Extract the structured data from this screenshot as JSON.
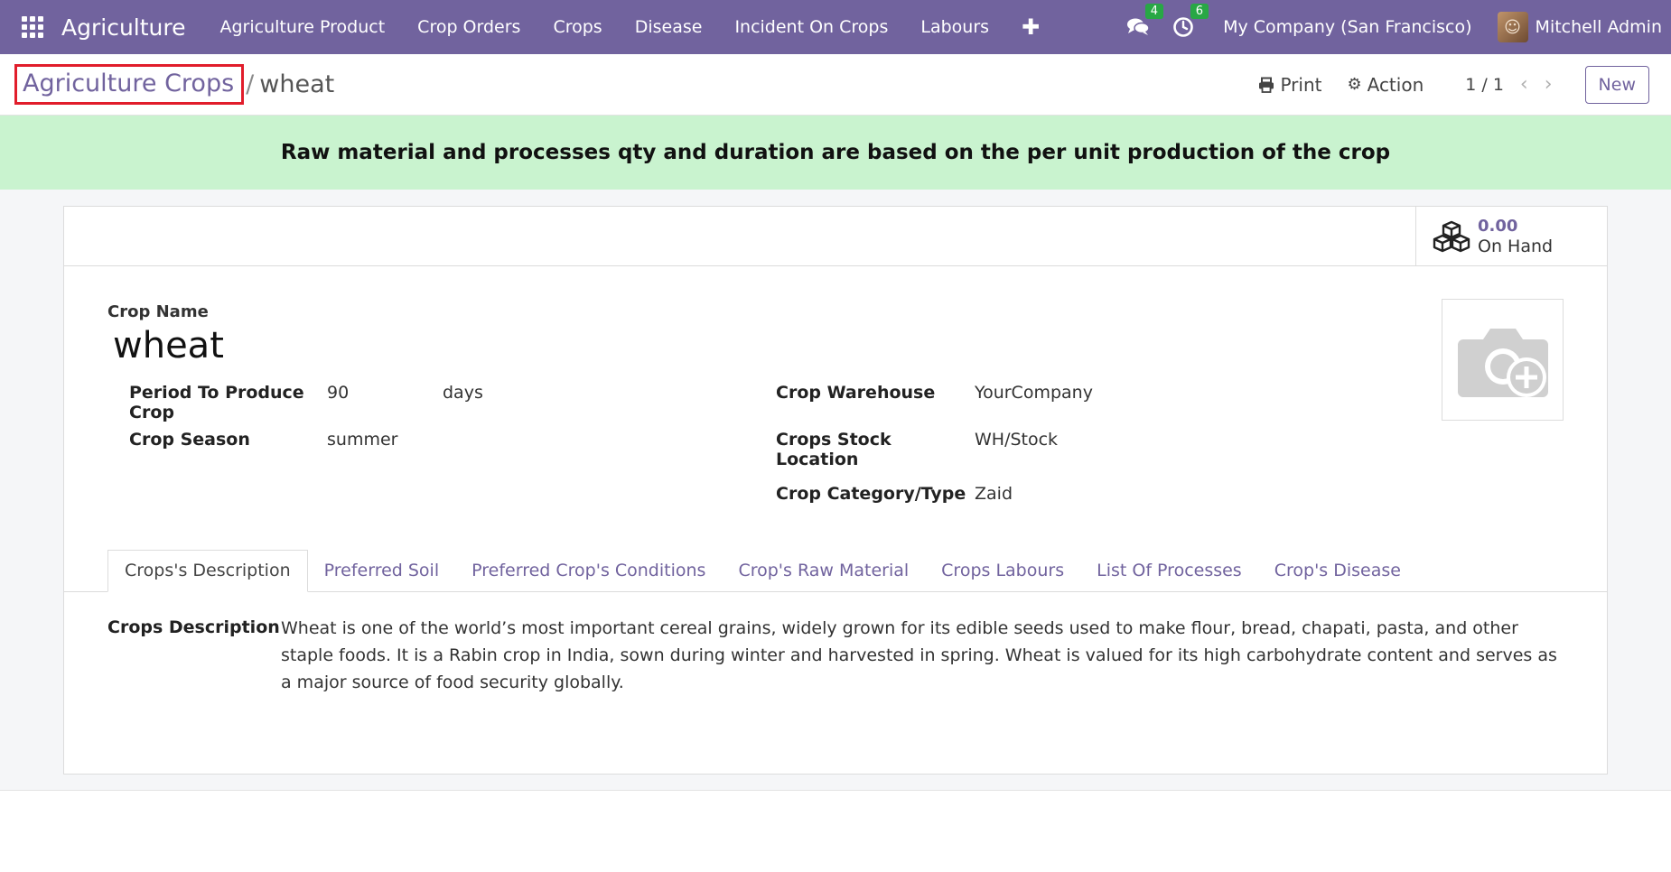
{
  "navbar": {
    "app_name": "Agriculture",
    "menu": [
      "Agriculture Product",
      "Crop Orders",
      "Crops",
      "Disease",
      "Incident On Crops",
      "Labours"
    ],
    "messages_count": "4",
    "activities_count": "6",
    "company": "My Company (San Francisco)",
    "user": "Mitchell Admin"
  },
  "breadcrumb": {
    "parent": "Agriculture Crops",
    "separator": "/",
    "current": "wheat"
  },
  "control": {
    "print_label": "Print",
    "action_label": "Action",
    "pager": "1 / 1",
    "new_label": "New"
  },
  "alert": {
    "text": "Raw material and processes qty and duration are based on the per unit production of the crop"
  },
  "smart_button": {
    "value": "0.00",
    "label": "On Hand"
  },
  "form": {
    "crop_name_label": "Crop Name",
    "crop_name": "wheat",
    "period_label": "Period To Produce Crop",
    "period_value": "90",
    "period_unit": "days",
    "season_label": "Crop Season",
    "season_value": "summer",
    "warehouse_label": "Crop Warehouse",
    "warehouse_value": "YourCompany",
    "stock_location_label": "Crops Stock Location",
    "stock_location_value": "WH/Stock",
    "category_label": "Crop Category/Type",
    "category_value": "Zaid"
  },
  "tabs": [
    "Crops's Description",
    "Preferred Soil",
    "Preferred Crop's Conditions",
    "Crop's Raw Material",
    "Crops Labours",
    "List Of Processes",
    "Crop's Disease"
  ],
  "description": {
    "label": "Crops Description",
    "text": "Wheat is one of the world’s most important cereal grains, widely grown for its edible seeds used to make flour, bread, chapati, pasta, and other staple foods. It is a Rabin crop in India, sown during winter and harvested in spring. Wheat is valued for its high carbohydrate content and serves as a major source of food security globally."
  },
  "colors": {
    "navbar": "#71639e",
    "accent": "#71639e",
    "alert_bg": "#c9f3cf",
    "badge": "#28a745",
    "highlight": "#e11d2b"
  }
}
